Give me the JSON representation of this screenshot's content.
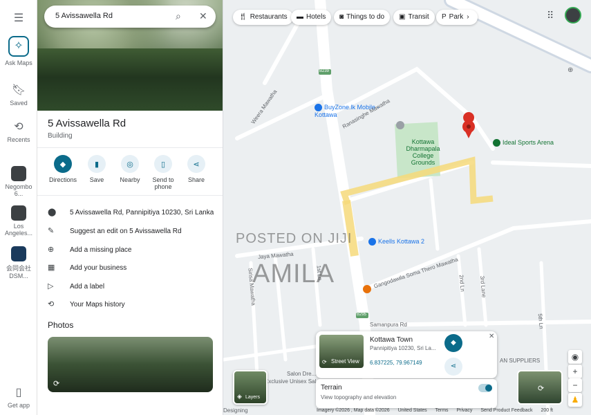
{
  "search": {
    "value": "5 Avissawella Rd"
  },
  "rail": {
    "ask_maps": "Ask Maps",
    "saved": "Saved",
    "recents": "Recents",
    "recent_items": [
      {
        "label": "Negombo 6..."
      },
      {
        "label": "Los Angeles..."
      },
      {
        "label": "会同会社 DSM..."
      }
    ],
    "get_app": "Get app"
  },
  "place": {
    "title": "5 Avissawella Rd",
    "category": "Building",
    "actions": [
      "Directions",
      "Save",
      "Nearby",
      "Send to phone",
      "Share"
    ],
    "details": [
      {
        "icon": "pin-icon",
        "text": "5 Avissawella Rd, Pannipitiya 10230, Sri Lanka"
      },
      {
        "icon": "edit-icon",
        "text": "Suggest an edit on 5 Avissawella Rd"
      },
      {
        "icon": "add-place-icon",
        "text": "Add a missing place"
      },
      {
        "icon": "business-icon",
        "text": "Add your business"
      },
      {
        "icon": "label-icon",
        "text": "Add a label"
      },
      {
        "icon": "history-icon",
        "text": "Your Maps history"
      }
    ],
    "photos_heading": "Photos"
  },
  "chips": [
    {
      "icon": "restaurant-icon",
      "label": "Restaurants"
    },
    {
      "icon": "hotel-icon",
      "label": "Hotels"
    },
    {
      "icon": "camera-icon",
      "label": "Things to do"
    },
    {
      "icon": "transit-icon",
      "label": "Transit"
    },
    {
      "icon": "parking-icon",
      "label": "Park"
    }
  ],
  "map": {
    "pois": [
      {
        "name": "BuyZone.lk Mobile - Kottawa"
      },
      {
        "name": "Kottawa Dharmapala College Grounds"
      },
      {
        "name": "Ideal Sports Arena"
      },
      {
        "name": "Keells Kottawa 2"
      }
    ],
    "streets": [
      "Weera Mawatha",
      "Ranasinghe Mawatha",
      "Jaya Mawatha",
      "Gangodawila Soma Thero Mawatha",
      "Samanpura Rd",
      "Sirisa Mawatha",
      "1st Ln",
      "2nd Ln",
      "3rd Lane",
      "5th Ln",
      "Salon Dre...",
      "Exclusive Unisex Sal...",
      "Designing",
      "AN SUPPLIERS"
    ],
    "route_badges": [
      "B239",
      "B295"
    ],
    "watermark": [
      "POSTED ON JIJI",
      "AMILA"
    ]
  },
  "card": {
    "title": "Kottawa Town",
    "address": "Pannipitiya 10230, Sri La...",
    "coords": "6.837225, 79.967149",
    "street_view": "Street View"
  },
  "terrain": {
    "title": "Terrain",
    "subtitle": "View topography and elevation"
  },
  "layers_label": "Layers",
  "footer": [
    "Imagery ©2026 , Map data ©2026",
    "United States",
    "Terms",
    "Privacy",
    "Send Product Feedback",
    "200 ft"
  ],
  "colors": {
    "accent": "#0b6b8a",
    "route": "#f6d97a",
    "park": "#c8e6c9",
    "pin": "#d93025"
  }
}
